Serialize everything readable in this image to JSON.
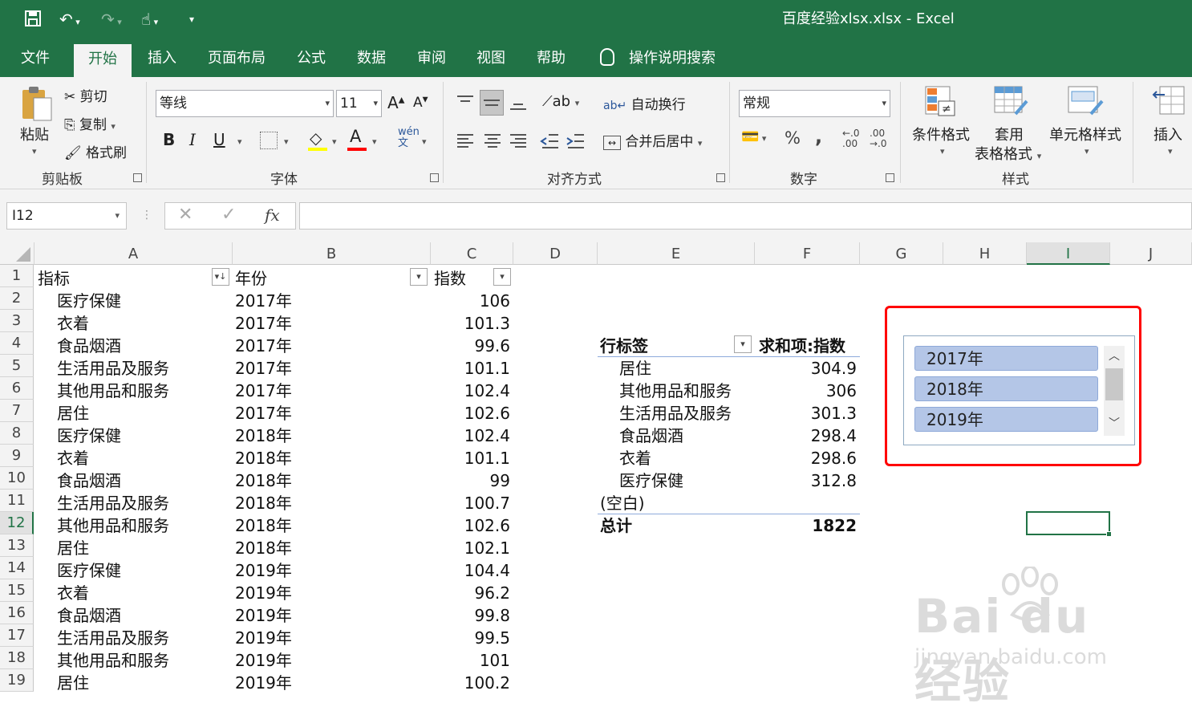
{
  "title_bar": {
    "title": "百度经验xlsx.xlsx  -  Excel"
  },
  "tabs": [
    "文件",
    "开始",
    "插入",
    "页面布局",
    "公式",
    "数据",
    "审阅",
    "视图",
    "帮助"
  ],
  "tell_me": "操作说明搜索",
  "ribbon": {
    "clipboard": {
      "paste": "粘贴",
      "cut": "剪切",
      "copy": "复制",
      "format_painter": "格式刷",
      "label": "剪贴板"
    },
    "font": {
      "name": "等线",
      "size": "11",
      "label": "字体",
      "bold": "B",
      "italic": "I",
      "underline": "U"
    },
    "alignment": {
      "wrap": "自动换行",
      "merge": "合并后居中",
      "label": "对齐方式"
    },
    "number": {
      "format": "常规",
      "percent": "%",
      "comma": ",",
      "label": "数字"
    },
    "styles": {
      "conditional": "条件格式",
      "table1": "套用",
      "table2": "表格格式",
      "cell_styles": "单元格样式",
      "label": "样式"
    },
    "cells": {
      "insert": "插入"
    }
  },
  "name_box": "I12",
  "columns": [
    "A",
    "B",
    "C",
    "D",
    "E",
    "F",
    "G",
    "H",
    "I",
    "J"
  ],
  "rows": [
    "1",
    "2",
    "3",
    "4",
    "5",
    "6",
    "7",
    "8",
    "9",
    "10",
    "11",
    "12",
    "13",
    "14",
    "15",
    "16",
    "17",
    "18",
    "19"
  ],
  "table": {
    "headers": [
      "指标",
      "年份",
      "指数"
    ],
    "data": [
      [
        "医疗保健",
        "2017年",
        "106"
      ],
      [
        "衣着",
        "2017年",
        "101.3"
      ],
      [
        "食品烟酒",
        "2017年",
        "99.6"
      ],
      [
        "生活用品及服务",
        "2017年",
        "101.1"
      ],
      [
        "其他用品和服务",
        "2017年",
        "102.4"
      ],
      [
        "居住",
        "2017年",
        "102.6"
      ],
      [
        "医疗保健",
        "2018年",
        "102.4"
      ],
      [
        "衣着",
        "2018年",
        "101.1"
      ],
      [
        "食品烟酒",
        "2018年",
        "99"
      ],
      [
        "生活用品及服务",
        "2018年",
        "100.7"
      ],
      [
        "其他用品和服务",
        "2018年",
        "102.6"
      ],
      [
        "居住",
        "2018年",
        "102.1"
      ],
      [
        "医疗保健",
        "2019年",
        "104.4"
      ],
      [
        "衣着",
        "2019年",
        "96.2"
      ],
      [
        "食品烟酒",
        "2019年",
        "99.8"
      ],
      [
        "生活用品及服务",
        "2019年",
        "99.5"
      ],
      [
        "其他用品和服务",
        "2019年",
        "101"
      ],
      [
        "居住",
        "2019年",
        "100.2"
      ]
    ]
  },
  "pivot": {
    "row_label": "行标签",
    "value_label": "求和项:指数",
    "rows": [
      [
        "居住",
        "304.9"
      ],
      [
        "其他用品和服务",
        "306"
      ],
      [
        "生活用品及服务",
        "301.3"
      ],
      [
        "食品烟酒",
        "298.4"
      ],
      [
        "衣着",
        "298.6"
      ],
      [
        "医疗保健",
        "312.8"
      ],
      [
        "(空白)",
        ""
      ]
    ],
    "total_label": "总计",
    "total_value": "1822"
  },
  "slicer": {
    "items": [
      "2017年",
      "2018年",
      "2019年"
    ]
  },
  "watermark": {
    "text": "Bai du 经验",
    "url": "jingyan.baidu.com"
  },
  "colors": {
    "excel_green": "#217346",
    "slicer_item": "#b4c6e7",
    "highlight_border": "#ff0000"
  }
}
